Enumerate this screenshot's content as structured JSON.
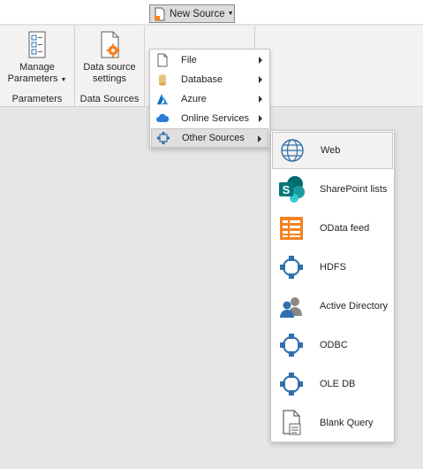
{
  "ribbon": {
    "parameters_group": {
      "manage_label_line1": "Manage",
      "manage_label_line2": "Parameters",
      "group_label": "Parameters"
    },
    "datasources_group": {
      "settings_label_line1": "Data source",
      "settings_label_line2": "settings",
      "group_label": "Data Sources"
    },
    "new_source_label": "New Source"
  },
  "source_menu": {
    "items": [
      {
        "label": "File",
        "icon": "file-icon"
      },
      {
        "label": "Database",
        "icon": "database-icon"
      },
      {
        "label": "Azure",
        "icon": "azure-icon"
      },
      {
        "label": "Online Services",
        "icon": "cloud-icon"
      },
      {
        "label": "Other Sources",
        "icon": "other-sources-icon"
      }
    ]
  },
  "other_sources_menu": {
    "items": [
      {
        "label": "Web",
        "icon": "globe-icon"
      },
      {
        "label": "SharePoint lists",
        "icon": "sharepoint-icon"
      },
      {
        "label": "OData feed",
        "icon": "odata-icon"
      },
      {
        "label": "HDFS",
        "icon": "connector-icon"
      },
      {
        "label": "Active Directory",
        "icon": "users-icon"
      },
      {
        "label": "ODBC",
        "icon": "connector-icon"
      },
      {
        "label": "OLE DB",
        "icon": "connector-icon"
      },
      {
        "label": "Blank Query",
        "icon": "blank-query-icon"
      }
    ]
  },
  "colors": {
    "accent_blue": "#2f6fad",
    "orange": "#f7821f",
    "sharepoint_teal": "#038387"
  }
}
